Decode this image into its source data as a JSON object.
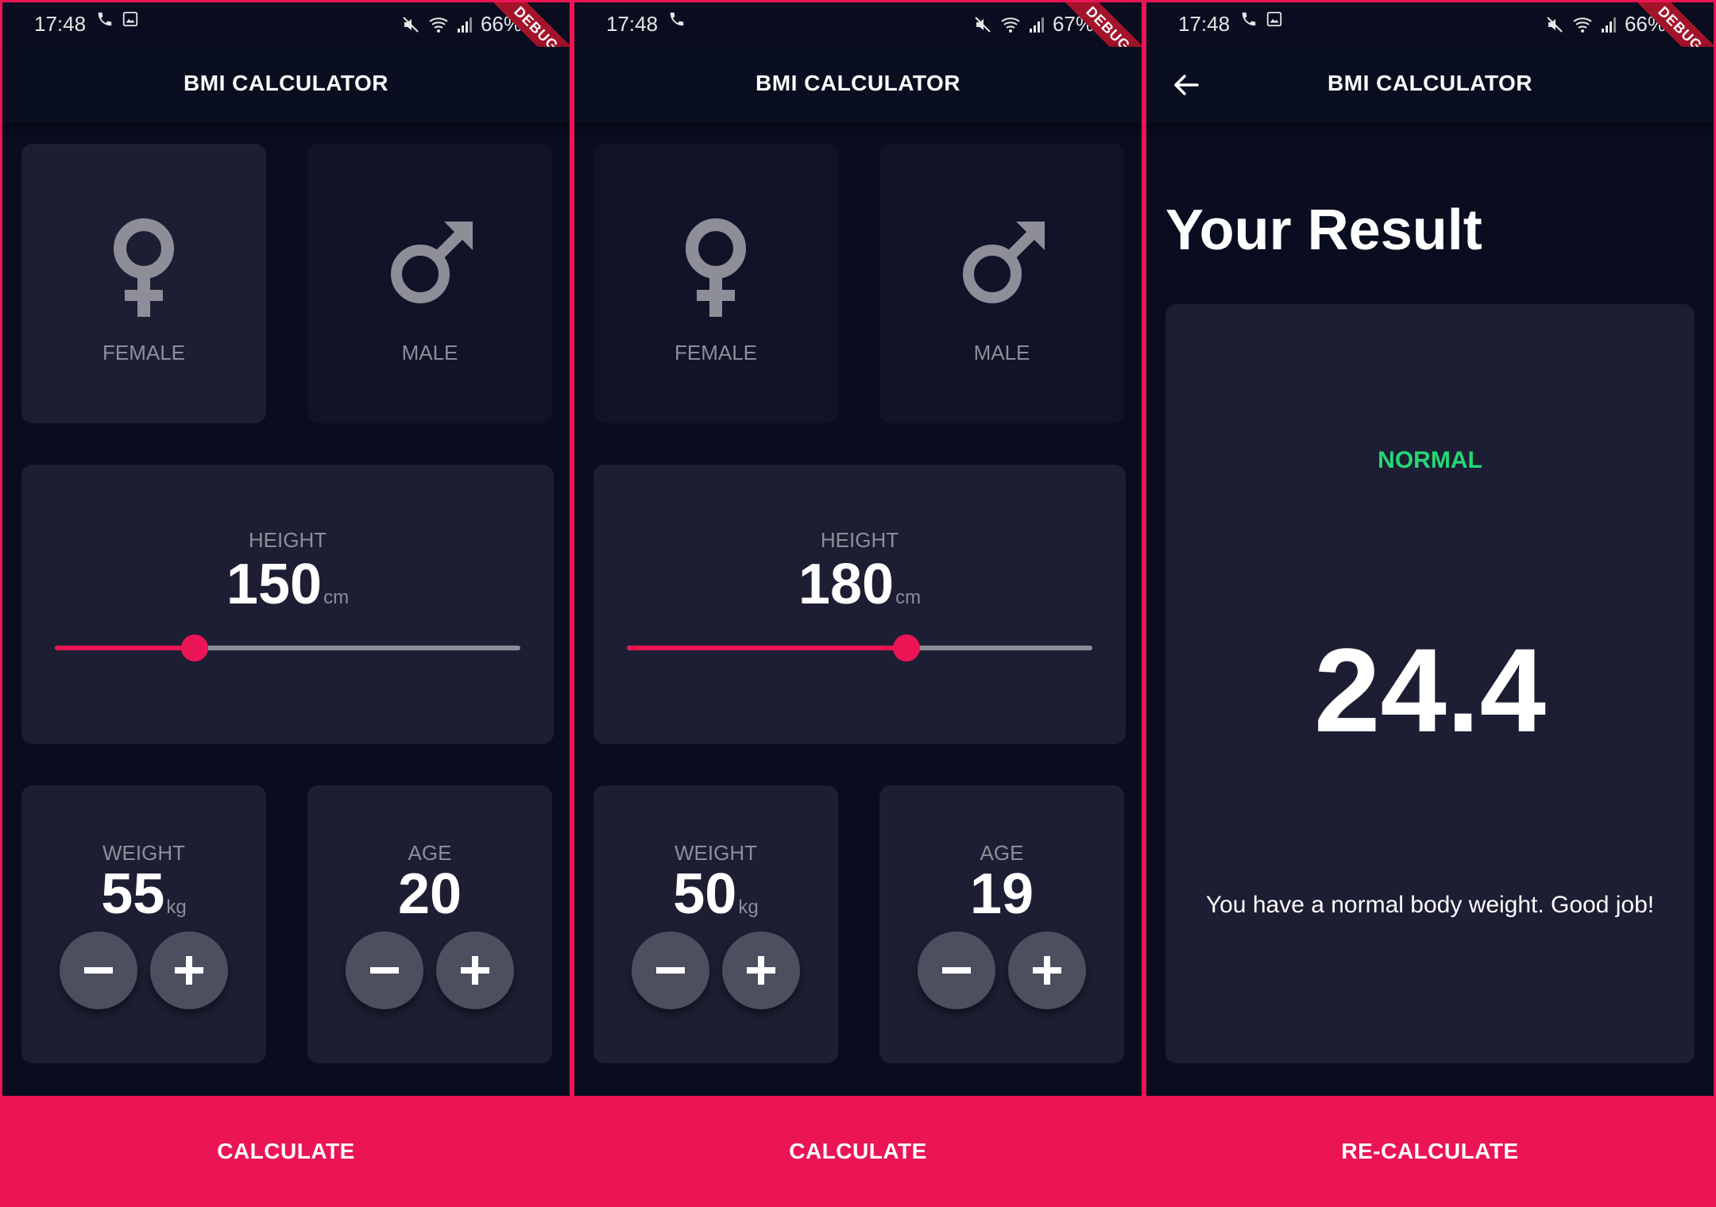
{
  "colors": {
    "background": "#090d1f",
    "card_active": "#1d1e33",
    "card_inactive": "#111328",
    "accent": "#eb1555",
    "label_grey": "#8d8e98",
    "normal_green": "#24d876",
    "round_button": "#4c4f5e"
  },
  "screens": [
    {
      "status": {
        "time": "17:48",
        "battery": "66%",
        "left_icons": [
          "phone-icon",
          "image-icon"
        ],
        "right_icons": [
          "mute-icon",
          "wifi-icon",
          "signal-icon",
          "battery-icon"
        ]
      },
      "debug_label": "DEBUG",
      "title": "BMI CALCULATOR",
      "female_label": "FEMALE",
      "male_label": "MALE",
      "selected_gender": "female",
      "height": {
        "label": "HEIGHT",
        "value": "150",
        "unit": "cm",
        "slider_fraction": 0.3
      },
      "weight": {
        "label": "WEIGHT",
        "value": "55",
        "unit": "kg"
      },
      "age": {
        "label": "AGE",
        "value": "20"
      },
      "button": "CALCULATE"
    },
    {
      "status": {
        "time": "17:48",
        "battery": "67%",
        "left_icons": [
          "phone-icon"
        ],
        "right_icons": [
          "mute-icon",
          "wifi-icon",
          "signal-icon",
          "battery-icon"
        ]
      },
      "debug_label": "DEBUG",
      "title": "BMI CALCULATOR",
      "female_label": "FEMALE",
      "male_label": "MALE",
      "selected_gender": "none",
      "height": {
        "label": "HEIGHT",
        "value": "180",
        "unit": "cm",
        "slider_fraction": 0.6
      },
      "weight": {
        "label": "WEIGHT",
        "value": "50",
        "unit": "kg"
      },
      "age": {
        "label": "AGE",
        "value": "19"
      },
      "button": "CALCULATE"
    },
    {
      "status": {
        "time": "17:48",
        "battery": "66%",
        "left_icons": [
          "phone-icon",
          "image-icon"
        ],
        "right_icons": [
          "mute-icon",
          "wifi-icon",
          "signal-icon",
          "battery-icon"
        ]
      },
      "debug_label": "DEBUG",
      "title": "BMI CALCULATOR",
      "result_title": "Your Result",
      "result_status": "NORMAL",
      "result_value": "24.4",
      "result_text": "You have a normal body weight. Good job!",
      "button": "RE-CALCULATE"
    }
  ]
}
